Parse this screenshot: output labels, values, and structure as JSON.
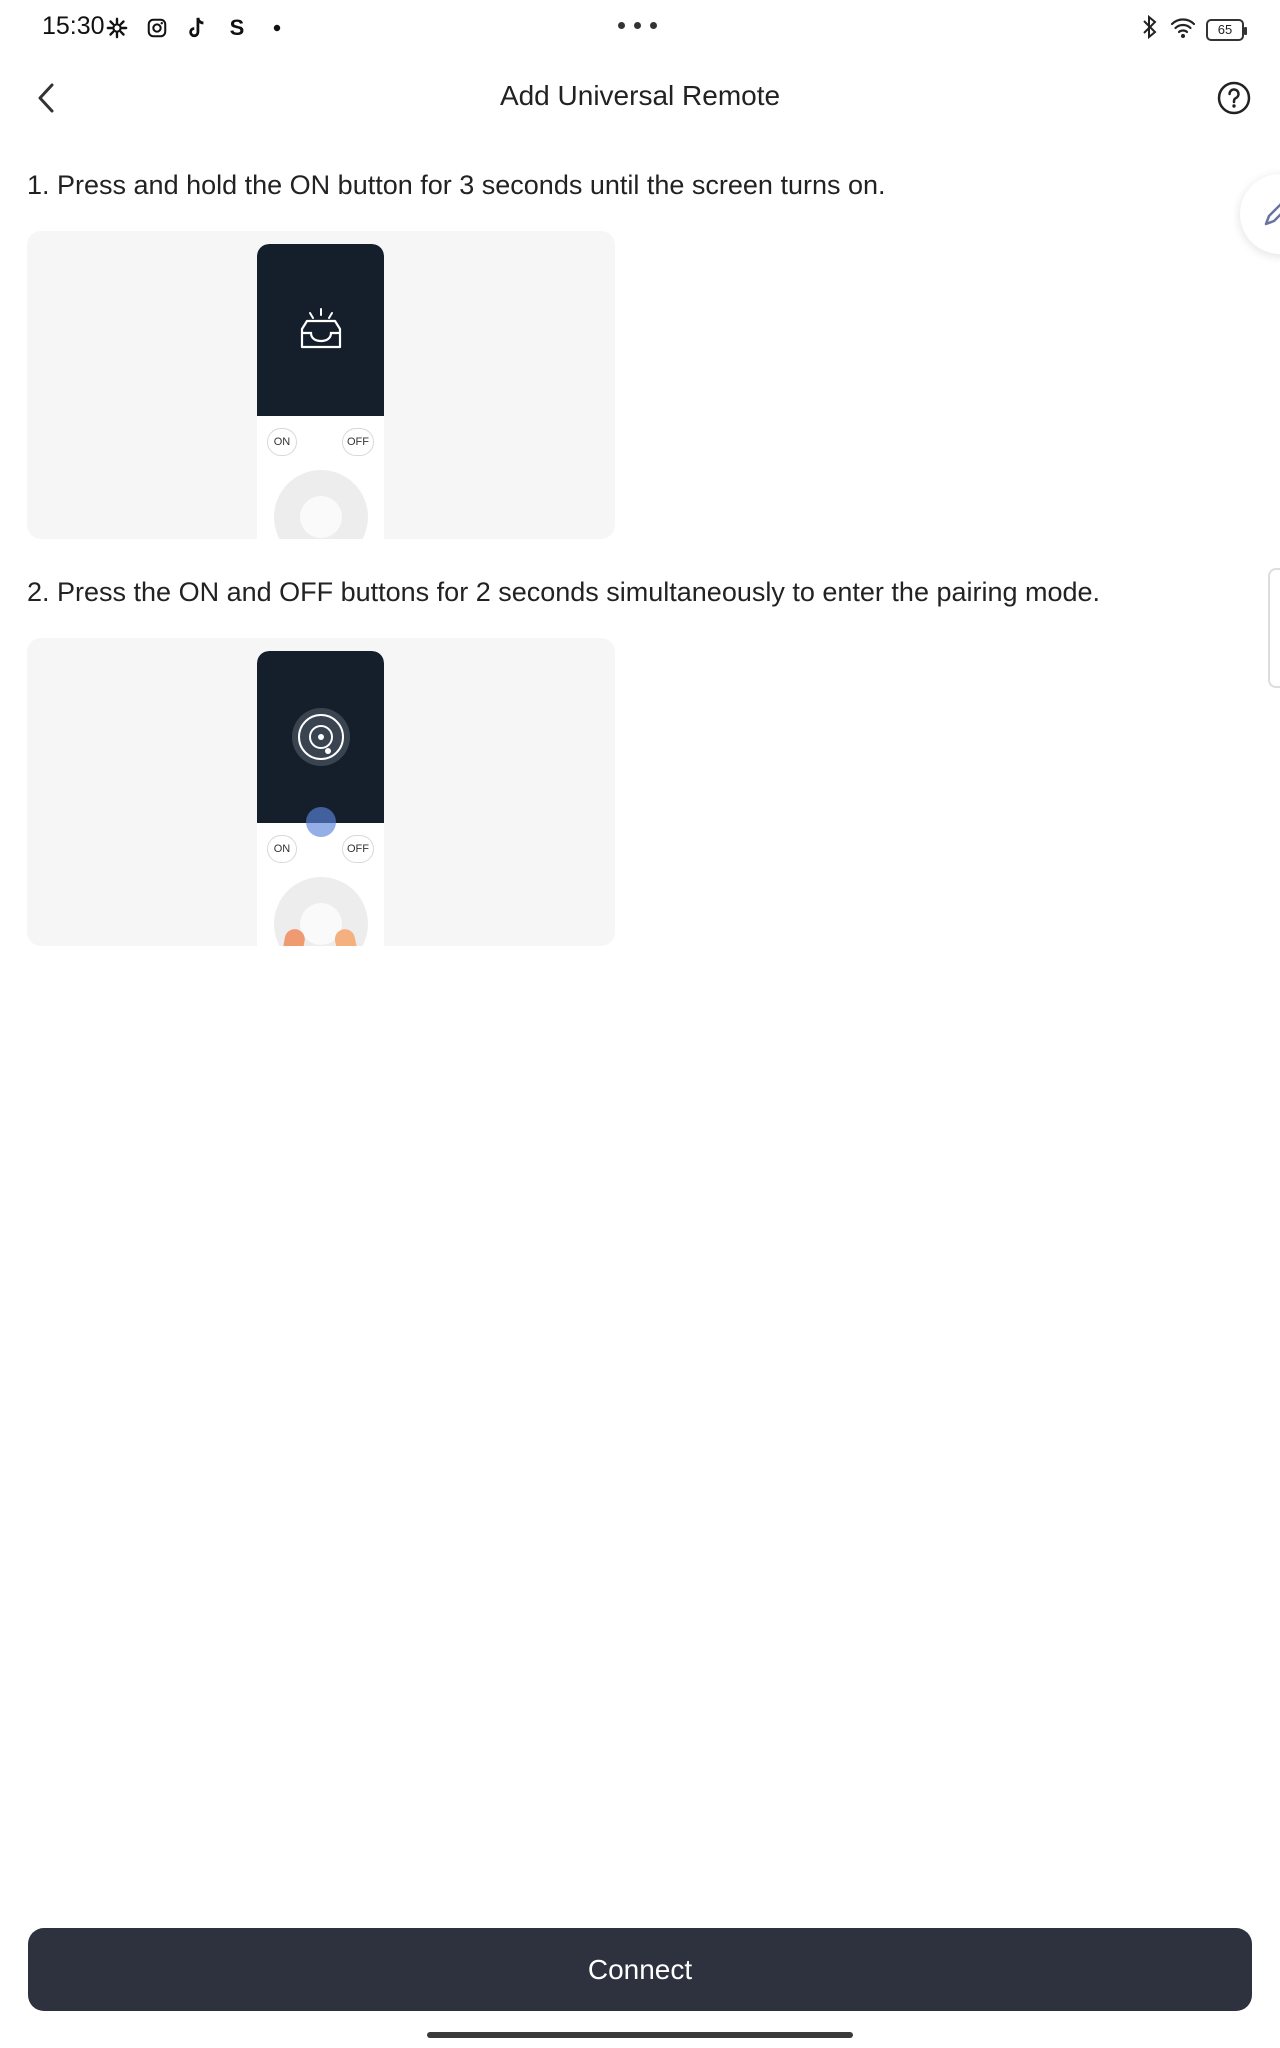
{
  "status_bar": {
    "time": "15:30",
    "left_icons": [
      "gear-icon",
      "instagram-icon",
      "tiktok-icon",
      "s-app-icon",
      "dot-icon"
    ],
    "s_app_glyph": "S",
    "battery": "65",
    "right_icons": [
      "bluetooth-icon",
      "wifi-icon",
      "battery-icon"
    ]
  },
  "header": {
    "title": "Add Universal Remote",
    "back_icon": "chevron-left-icon",
    "help_icon": "question-circle-icon"
  },
  "steps": [
    {
      "text": "1. Press and hold the ON button for 3 seconds until the screen turns on.",
      "illustration": {
        "screen_icon": "lamp-on-icon",
        "on_label": "ON",
        "off_label": "OFF"
      }
    },
    {
      "text": "2. Press the ON and OFF buttons for 2 seconds simultaneously to enter the pairing mode.",
      "illustration": {
        "screen_icon": "radar-icon",
        "on_label": "ON",
        "off_label": "OFF"
      }
    }
  ],
  "edit_tab_icon": "pencil-icon",
  "connect_button": {
    "label": "Connect",
    "color": "#2d323e"
  },
  "colors": {
    "remote_screen": "#151f2c",
    "card_background": "#f6f6f6"
  }
}
